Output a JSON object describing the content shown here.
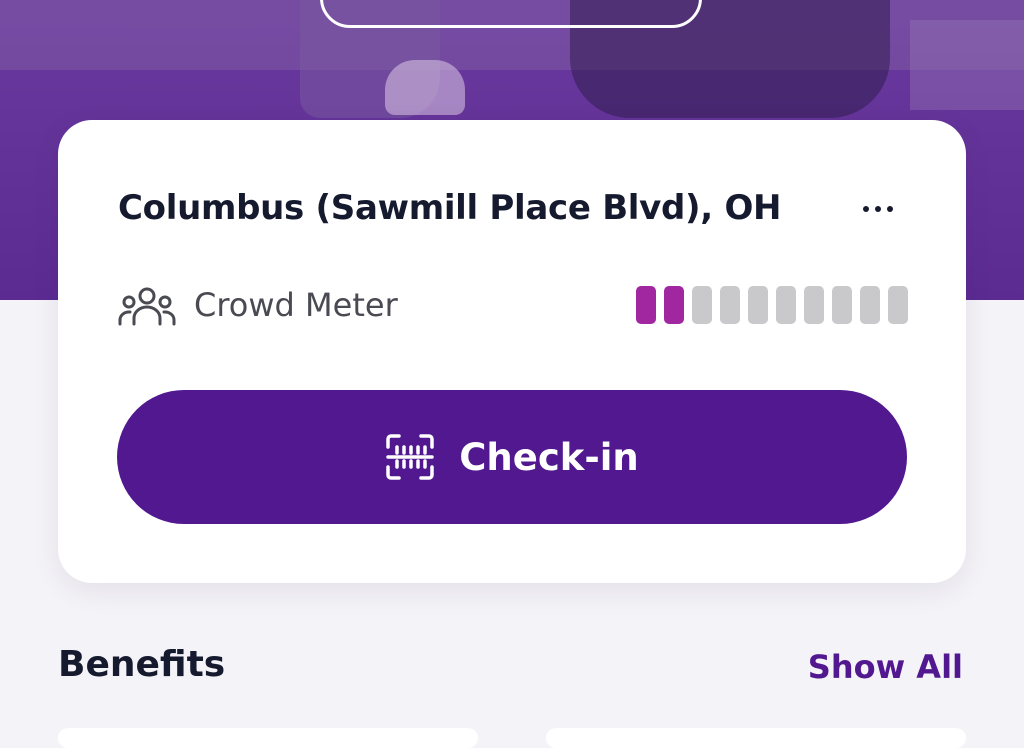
{
  "hero": {
    "button_label": ""
  },
  "location_card": {
    "title": "Columbus (Sawmill Place Blvd), OH",
    "more_icon": "more-horizontal-icon",
    "crowd_meter": {
      "label": "Crowd Meter",
      "icon": "people-group-icon",
      "level": 2,
      "max": 10,
      "active_color": "#a0279f",
      "inactive_color": "#c9c9cc"
    },
    "checkin": {
      "label": "Check-in",
      "icon": "barcode-scan-icon",
      "color": "#51188f"
    }
  },
  "benefits": {
    "title": "Benefits",
    "show_all_label": "Show All"
  },
  "colors": {
    "brand_purple": "#51188f",
    "hero_purple": "#5a2a91",
    "text_dark": "#161a2e"
  }
}
